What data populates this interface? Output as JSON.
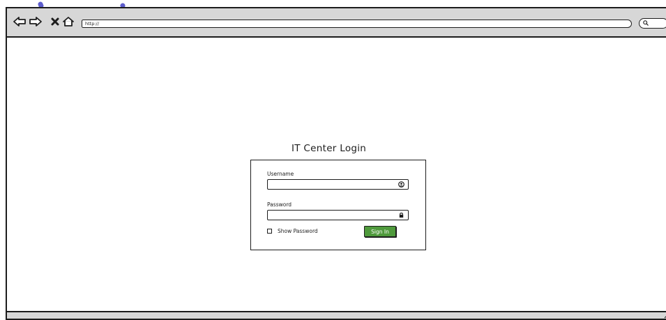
{
  "browser": {
    "url": "http://",
    "icons": {
      "back": "arrow-left-icon",
      "forward": "arrow-right-icon",
      "stop": "close-icon",
      "home": "home-icon",
      "search": "search-icon",
      "resize": "resize-grip-icon"
    }
  },
  "login": {
    "title": "IT Center Login",
    "username_label": "Username",
    "username_value": "",
    "password_label": "Password",
    "password_value": "",
    "show_password_label": "Show Password",
    "show_password_checked": false,
    "sign_in_label": "Sign In"
  },
  "colors": {
    "chrome_gray": "#d7d7d7",
    "outline": "#1c1c1c",
    "button_green": "#4f9a3c",
    "watermark": "#4b4bc8"
  }
}
